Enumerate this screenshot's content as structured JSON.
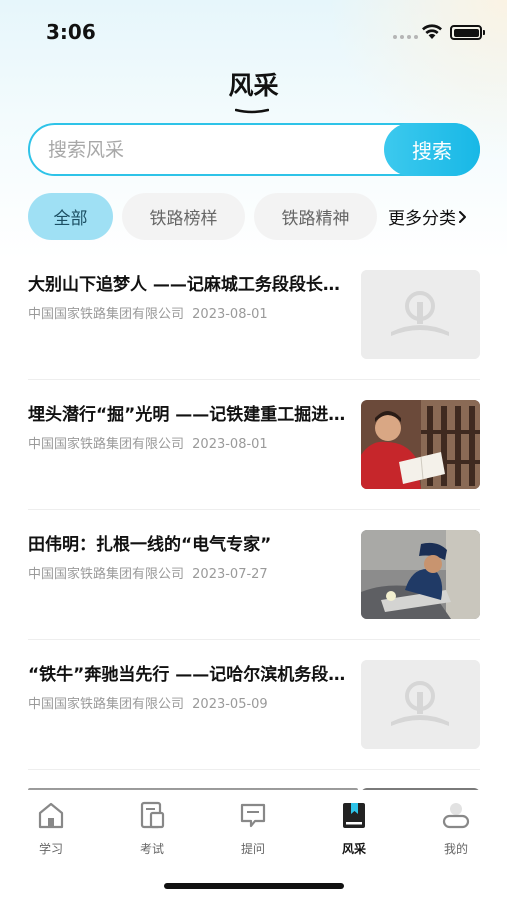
{
  "status_bar": {
    "time": "3:06"
  },
  "header": {
    "title": "风采"
  },
  "search": {
    "placeholder": "搜索风采",
    "button_label": "搜索"
  },
  "tabs": [
    {
      "label": "全部",
      "active": true
    },
    {
      "label": "铁路榜样",
      "active": false
    },
    {
      "label": "铁路精神",
      "active": false
    }
  ],
  "more_categories": "更多分类",
  "articles": [
    {
      "title": "大别山下追梦人 ——记麻城工务段段长…",
      "source": "中国国家铁路集团有限公司",
      "date": "2023-08-01",
      "thumb": "placeholder"
    },
    {
      "title": "埋头潜行“掘”光明 ——记铁建重工掘进机…",
      "source": "中国国家铁路集团有限公司",
      "date": "2023-08-01",
      "thumb": "photo-reading"
    },
    {
      "title": "田伟明：扎根一线的“电气专家”",
      "source": "中国国家铁路集团有限公司",
      "date": "2023-07-27",
      "thumb": "photo-worker"
    },
    {
      "title": "“铁牛”奔驰当先行 ——记哈尔滨机务段…",
      "source": "中国国家铁路集团有限公司",
      "date": "2023-05-09",
      "thumb": "placeholder"
    }
  ],
  "tabbar": [
    {
      "label": "学习",
      "icon": "home-icon",
      "active": false
    },
    {
      "label": "考试",
      "icon": "exam-icon",
      "active": false
    },
    {
      "label": "提问",
      "icon": "chat-icon",
      "active": false
    },
    {
      "label": "风采",
      "icon": "bookmark-book-icon",
      "active": true
    },
    {
      "label": "我的",
      "icon": "profile-icon",
      "active": false
    }
  ],
  "colors": {
    "accent": "#2ec3e8",
    "active_tab_bg": "#9fe0f4"
  }
}
